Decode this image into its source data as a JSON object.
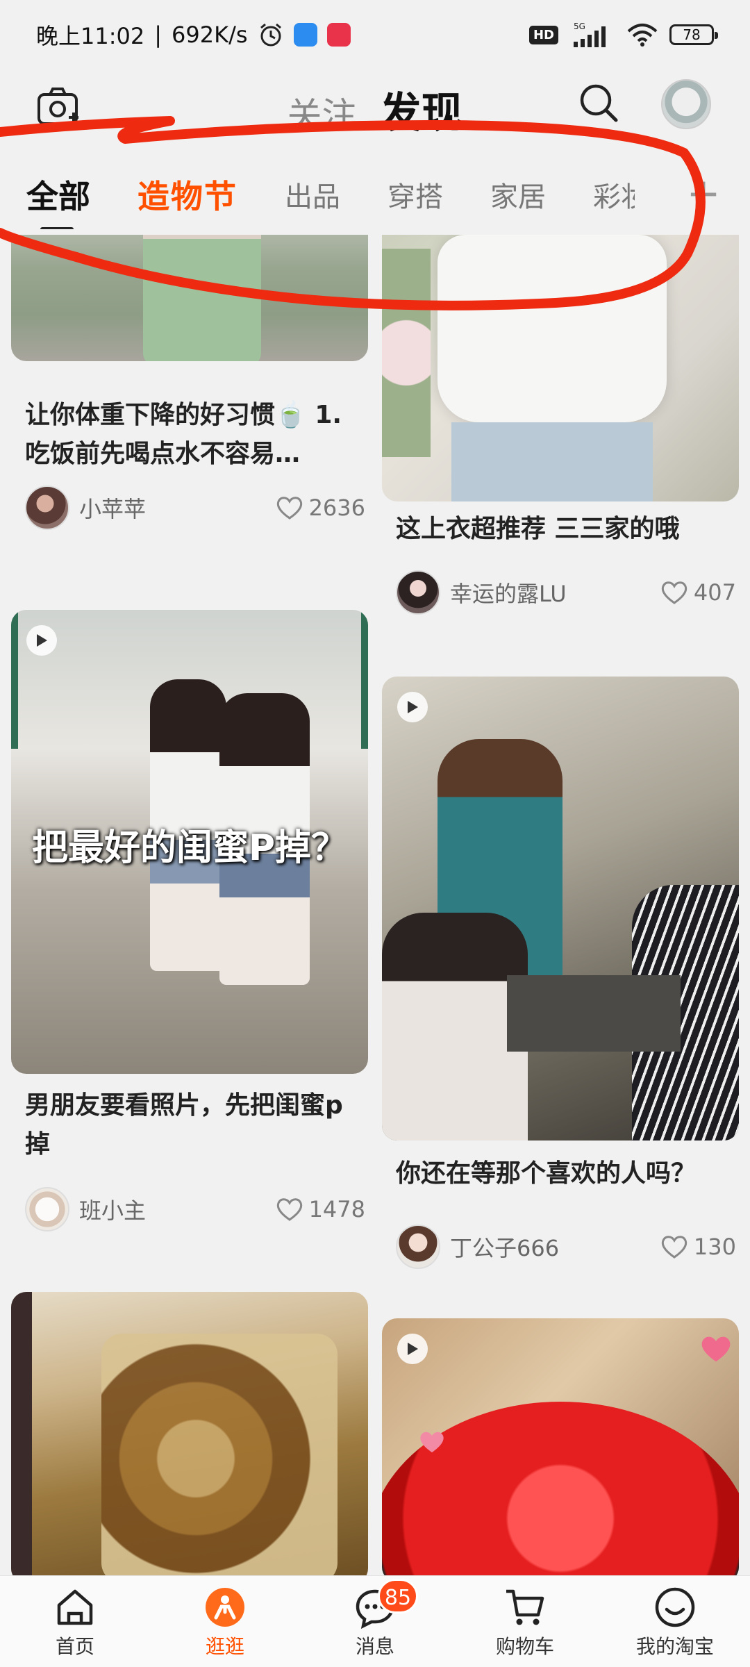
{
  "status_bar": {
    "time": "晚上11:02",
    "speed": "692K/s",
    "network": "5G",
    "hd": "HD",
    "battery": "78"
  },
  "header": {
    "tabs": [
      {
        "label": "关注",
        "active": false
      },
      {
        "label": "发现",
        "active": true
      }
    ],
    "categories": [
      "全部",
      "造物节",
      "出品",
      "穿搭",
      "家居",
      "彩妆"
    ],
    "active_category": "全部",
    "add_label": "+"
  },
  "feed": {
    "left": [
      {
        "title": "让你体重下降的好习惯🍵 1.吃饭前先喝点水不容易…",
        "author": "小苹苹",
        "likes": "2636",
        "video": false
      },
      {
        "title": "男朋友要看照片，先把闺蜜p掉",
        "author": "班小主",
        "likes": "1478",
        "video": true,
        "overlay": "把最好的闺蜜P掉？"
      },
      {
        "video": false
      }
    ],
    "right": [
      {
        "title": "这上衣超推荐 三三家的哦",
        "author": "幸运的露LU",
        "likes": "407",
        "video": false
      },
      {
        "title": "你还在等那个喜欢的人吗？",
        "author": "丁公子666",
        "likes": "130",
        "video": true
      },
      {
        "video": true
      }
    ]
  },
  "bottom_nav": {
    "items": [
      {
        "label": "首页",
        "icon": "home-icon",
        "active": false
      },
      {
        "label": "逛逛",
        "icon": "browse-icon",
        "active": true
      },
      {
        "label": "消息",
        "icon": "message-icon",
        "active": false,
        "badge": "85"
      },
      {
        "label": "购物车",
        "icon": "cart-icon",
        "active": false
      },
      {
        "label": "我的淘宝",
        "icon": "profile-icon",
        "active": false
      }
    ]
  },
  "colors": {
    "accent": "#ff5000",
    "annotation": "#ee2a10",
    "badge": "#ff4a1a"
  }
}
